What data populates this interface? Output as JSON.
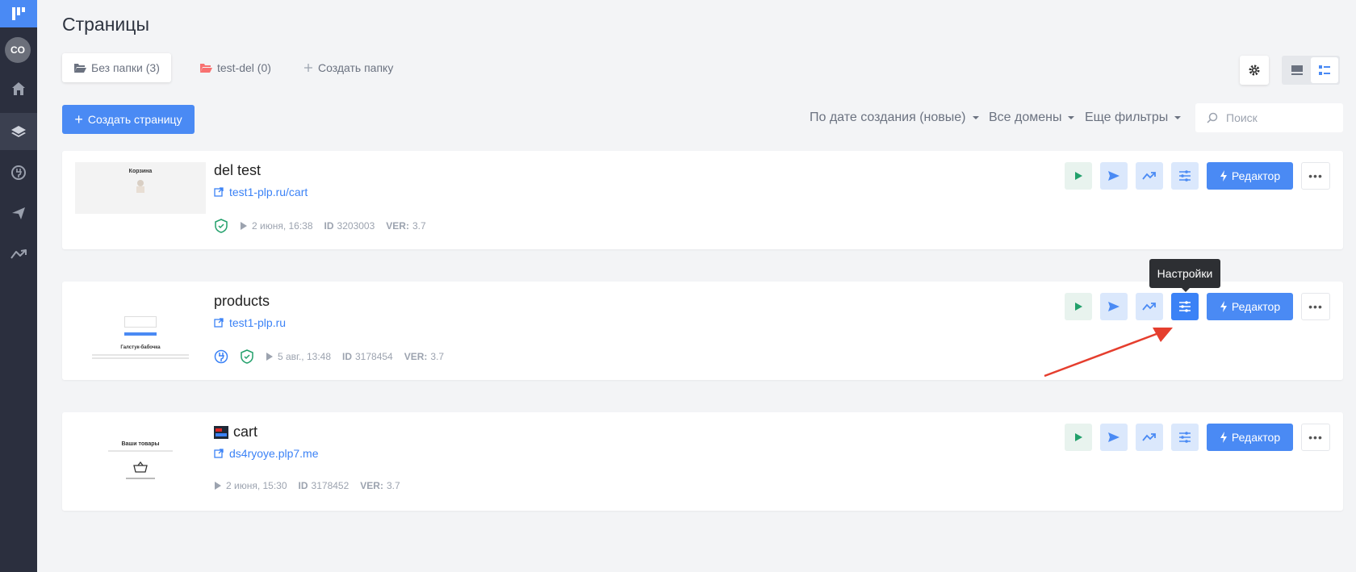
{
  "sidebar": {
    "avatar": "CO",
    "items": [
      {
        "icon": "home-icon"
      },
      {
        "icon": "layers-icon",
        "active": true
      },
      {
        "icon": "plugin-icon"
      },
      {
        "icon": "send-icon"
      },
      {
        "icon": "analytics-icon"
      }
    ]
  },
  "header": {
    "title": "Страницы"
  },
  "folders": [
    {
      "label": "Без папки (3)",
      "active": true,
      "icon": "folder-open-icon"
    },
    {
      "label": "test-del (0)",
      "icon": "folder-open-icon",
      "color": "#f87171"
    },
    {
      "label": "Создать папку",
      "icon": "plus-icon"
    }
  ],
  "toolbar": {
    "create_label": "Создать страницу",
    "sort_label": "По дате создания (новые)",
    "domains_label": "Все домены",
    "filters_label": "Еще фильтры",
    "search_placeholder": "Поиск"
  },
  "cards": [
    {
      "title": "del test",
      "link": "test1-plp.ru/cart",
      "date": "2 июня, 16:38",
      "id_label": "ID",
      "id": "3203003",
      "ver_label": "VER:",
      "ver": "3.7",
      "thumb_title": "Корзина"
    },
    {
      "title": "products",
      "link": "test1-plp.ru",
      "date": "5 авг., 13:48",
      "id_label": "ID",
      "id": "3178454",
      "ver_label": "VER:",
      "ver": "3.7",
      "thumb_title": "Галстук-бабочка"
    },
    {
      "title": "cart",
      "link": "ds4ryoye.plp7.me",
      "date": "2 июня, 15:30",
      "id_label": "ID",
      "id": "3178452",
      "ver_label": "VER:",
      "ver": "3.7",
      "thumb_title": "Ваши товары"
    }
  ],
  "editor_label": "Редактор",
  "tooltip": "Настройки",
  "colors": {
    "accent": "#4a8af4",
    "sidebar": "#2b2f3e",
    "arrow": "#e53e2e"
  }
}
